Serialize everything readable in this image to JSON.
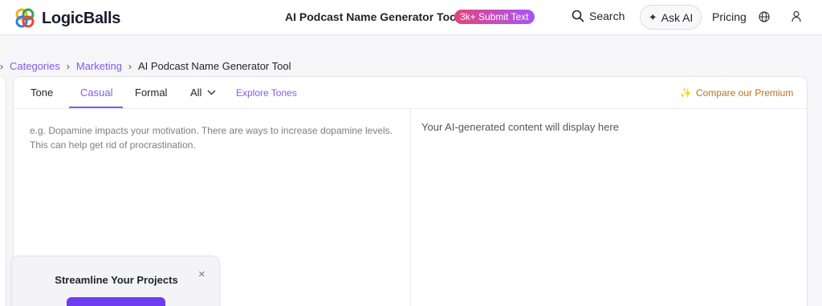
{
  "header": {
    "logo_text": "LogicBalls",
    "page_name": "AI Podcast Name Generator Tool",
    "submit_badge": "3k+ Submit Text",
    "search_label": "Search",
    "ask_ai_label": "Ask AI",
    "pricing_label": "Pricing"
  },
  "breadcrumb": {
    "items": [
      "Categories",
      "Marketing",
      "AI Podcast Name Generator Tool"
    ]
  },
  "tabs": {
    "tone_label": "Tone",
    "casual_label": "Casual",
    "formal_label": "Formal",
    "all_label": "All",
    "explore_label": "Explore Tones",
    "compare_label": "Compare our Premium",
    "active": "Casual"
  },
  "editor": {
    "input_placeholder": "e.g. Dopamine impacts your motivation. There are ways to increase dopamine levels. This can help get rid of procrastination.",
    "output_placeholder": "Your AI-generated content will display here"
  },
  "popup": {
    "title": "Streamline Your Projects",
    "close_symbol": "×"
  },
  "colors": {
    "accent": "#7c5cf0",
    "premium": "#b8711a",
    "badge_start": "#e0457b",
    "badge_end": "#a855f7"
  },
  "icons": [
    "logo-icon",
    "search-icon",
    "sparkle-icon",
    "globe-icon",
    "user-icon",
    "chevron-down-icon",
    "chevron-right-icon",
    "close-icon"
  ]
}
